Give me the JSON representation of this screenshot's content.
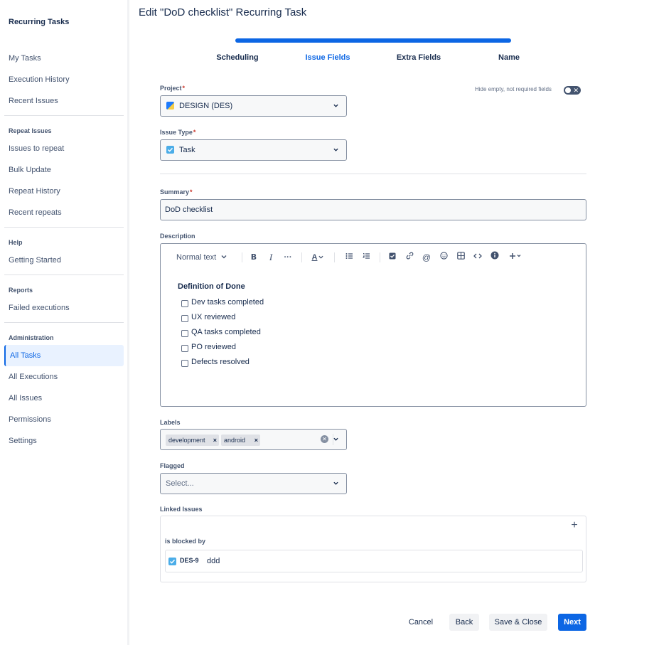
{
  "sidebar": {
    "app_title": "Recurring Tasks",
    "items_top": [
      "My Tasks",
      "Execution History",
      "Recent Issues"
    ],
    "section_repeat": "Repeat Issues",
    "items_repeat": [
      "Issues to repeat",
      "Bulk Update",
      "Repeat History",
      "Recent repeats"
    ],
    "section_help": "Help",
    "items_help": [
      "Getting Started"
    ],
    "section_reports": "Reports",
    "items_reports": [
      "Failed executions"
    ],
    "section_admin": "Administration",
    "items_admin": [
      "All Tasks",
      "All Executions",
      "All Issues",
      "Permissions",
      "Settings"
    ],
    "active_item": "All Tasks"
  },
  "page": {
    "title": "Edit \"DoD checklist\" Recurring Task"
  },
  "wizard": {
    "steps": [
      "Scheduling",
      "Issue Fields",
      "Extra Fields",
      "Name"
    ],
    "current_step": "Issue Fields",
    "progress": 1.0
  },
  "form": {
    "project_label": "Project",
    "project_value": "DESIGN (DES)",
    "hide_empty_label": "Hide empty, not required fields",
    "issue_type_label": "Issue Type",
    "issue_type_value": "Task",
    "summary_label": "Summary",
    "summary_value": "DoD checklist",
    "required_marker": "*",
    "description_label": "Description",
    "labels_label": "Labels",
    "labels": [
      "development",
      "android"
    ],
    "flagged_label": "Flagged",
    "flagged_placeholder": "Select...",
    "linked_label": "Linked Issues"
  },
  "editor": {
    "text_style": "Normal text",
    "heading": "Definition of Done",
    "checklist": [
      "Dev tasks completed",
      "UX reviewed",
      "QA tasks completed",
      "PO reviewed",
      "Defects resolved"
    ]
  },
  "linked": {
    "relation": "is blocked by",
    "issue_key": "DES-9",
    "issue_summary": "ddd"
  },
  "footer": {
    "cancel": "Cancel",
    "back": "Back",
    "save_close": "Save & Close",
    "next": "Next"
  },
  "colors": {
    "accent": "#0c66e4",
    "task_icon": "#4bade8"
  }
}
